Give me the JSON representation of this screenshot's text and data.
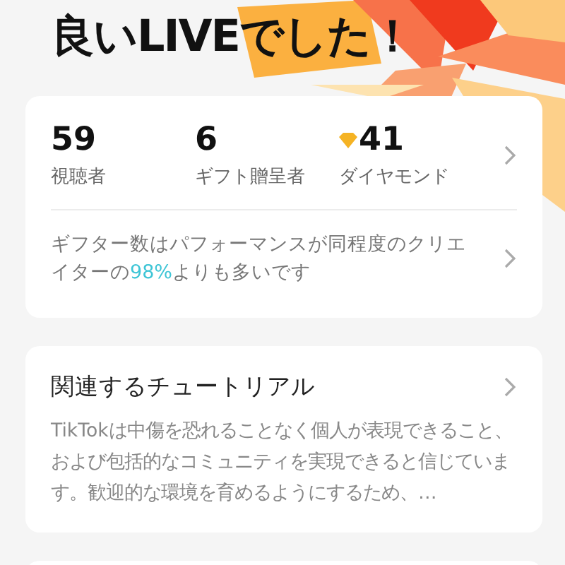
{
  "title": "良いLIVEでした！",
  "stats": [
    {
      "value": "59",
      "label": "視聴者",
      "kind": "plain"
    },
    {
      "value": "6",
      "label": "ギフト贈呈者",
      "kind": "plain"
    },
    {
      "value": "41",
      "label": "ダイヤモンド",
      "kind": "diamond"
    }
  ],
  "gifter_note": {
    "text_before": "ギフター数はパフォーマンスが同程度のクリエイターの",
    "highlight": "98%",
    "text_after": "よりも多いです"
  },
  "tutorial": {
    "title": "関連するチュートリアル",
    "description": "TikTokは中傷を恐れることなく個人が表現できること、および包括的なコミュニティを実現できると信じています。歓迎的な環境を育めるようにするため、…"
  }
}
